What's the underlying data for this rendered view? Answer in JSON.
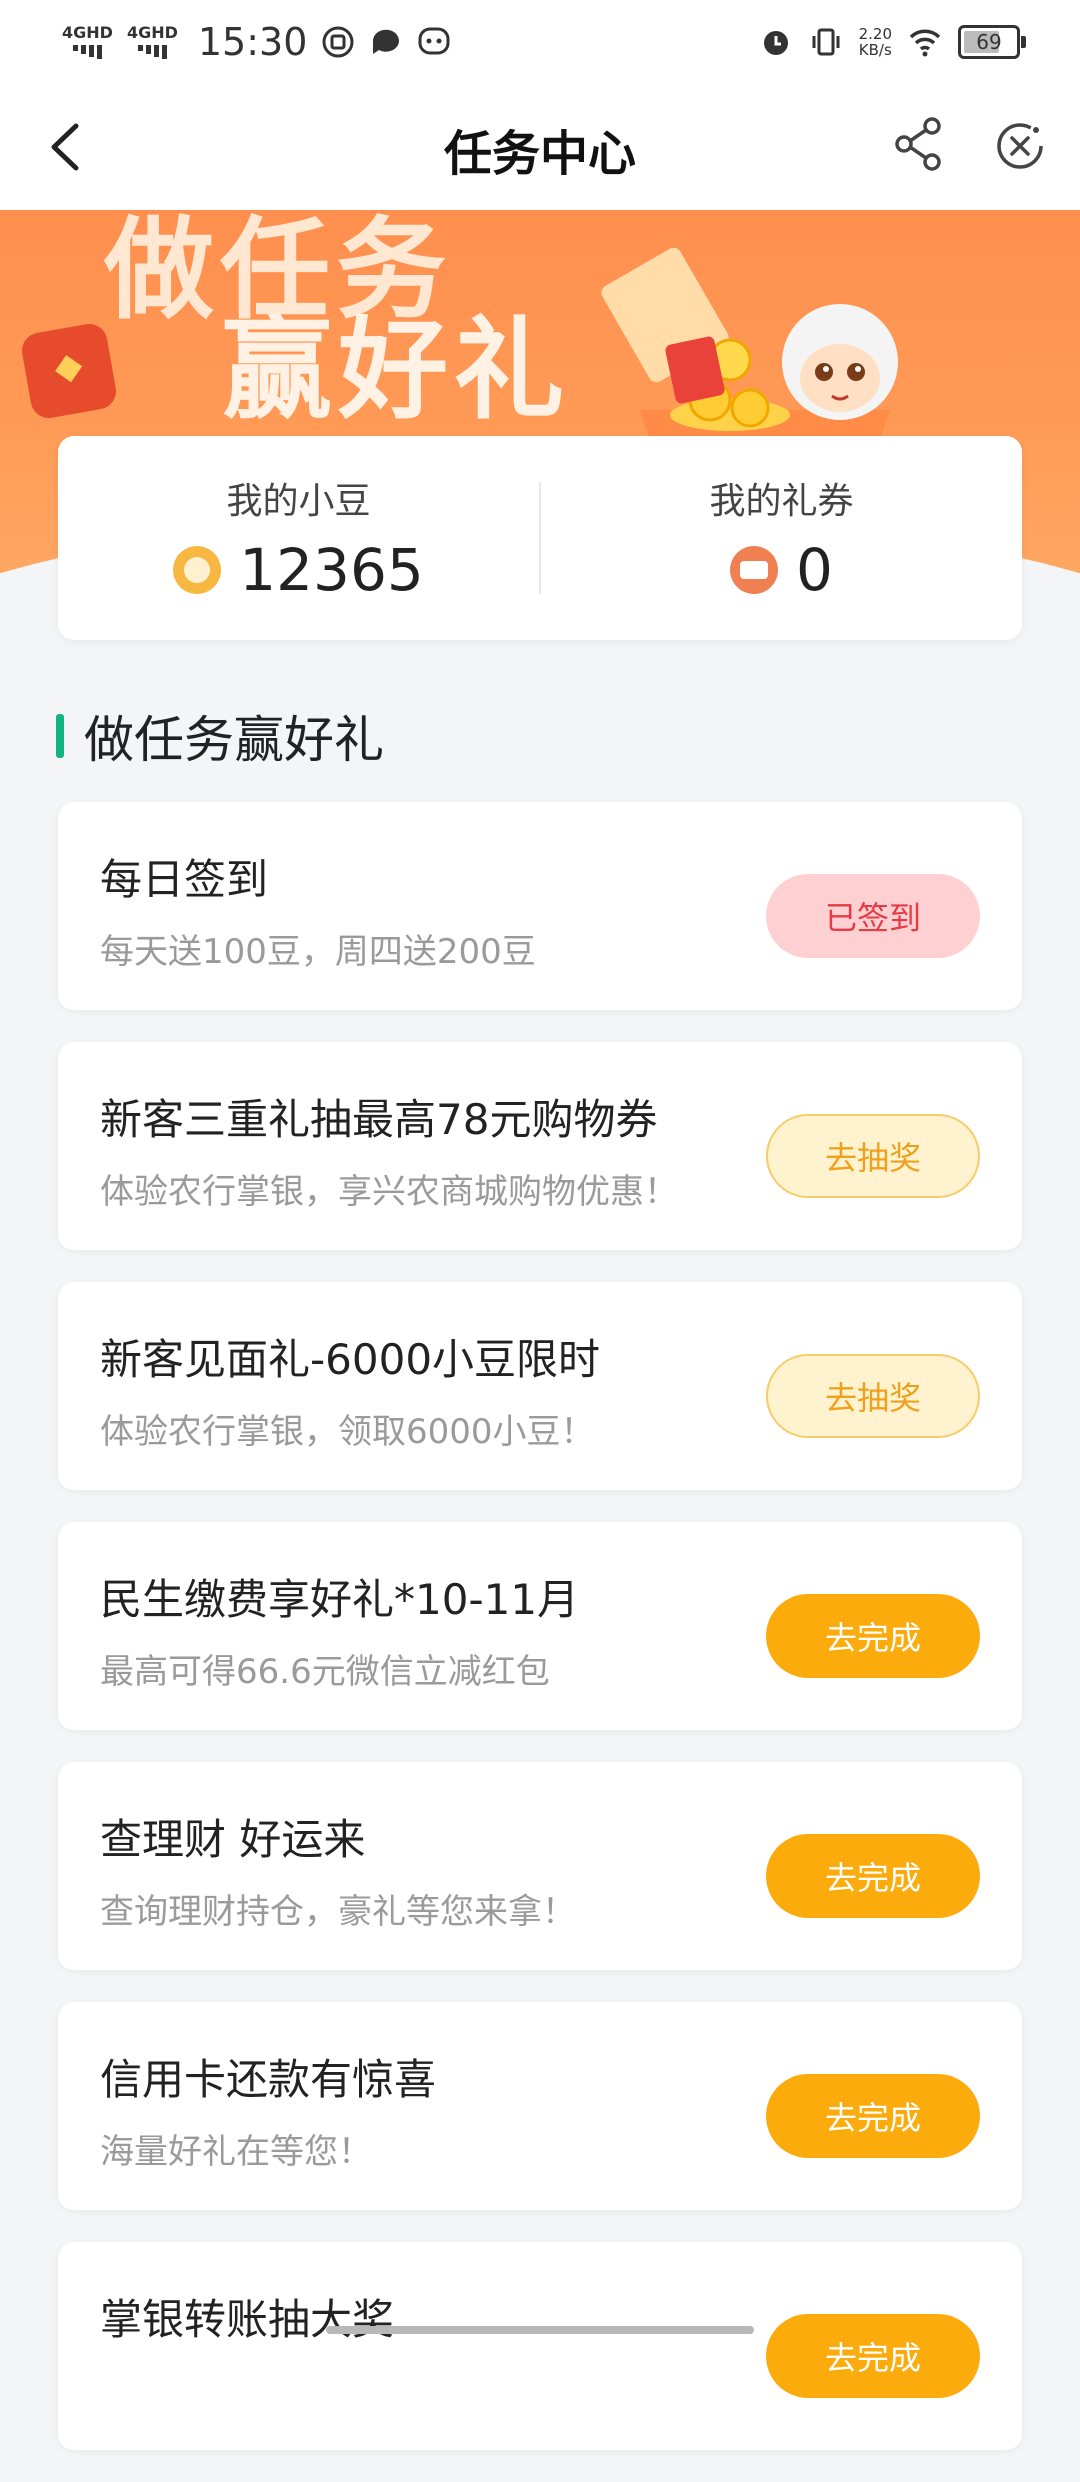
{
  "status_bar": {
    "signal1": "4GHD",
    "signal2": "4GHD",
    "time": "15:30",
    "speed_value": "2.20",
    "speed_unit": "KB/s",
    "battery": "69"
  },
  "nav": {
    "title": "任务中心"
  },
  "banner": {
    "line1": "做任务",
    "line2": "赢好礼"
  },
  "summary": {
    "beans_label": "我的小豆",
    "beans_value": "12365",
    "coupons_label": "我的礼券",
    "coupons_value": "0"
  },
  "section": {
    "title": "做任务赢好礼"
  },
  "tasks": [
    {
      "title": "每日签到",
      "desc": "每天送100豆，周四送200豆",
      "button": "已签到"
    },
    {
      "title": "新客三重礼抽最高78元购物券",
      "desc": "体验农行掌银，享兴农商城购物优惠！",
      "button": "去抽奖"
    },
    {
      "title": "新客见面礼-6000小豆限时",
      "desc": "体验农行掌银，领取6000小豆！",
      "button": "去抽奖"
    },
    {
      "title": "民生缴费享好礼*10-11月",
      "desc": "最高可得66.6元微信立减红包",
      "button": "去完成"
    },
    {
      "title": "查理财 好运来",
      "desc": "查询理财持仓，豪礼等您来拿！",
      "button": "去完成"
    },
    {
      "title": "信用卡还款有惊喜",
      "desc": "海量好礼在等您！",
      "button": "去完成"
    },
    {
      "title": "掌银转账抽大奖",
      "desc": "",
      "button": "去完成"
    }
  ],
  "colors": {
    "accent_green": "#14b384",
    "button_orange": "#fbab0b",
    "signed_bg": "#ffd0d2",
    "signed_text": "#e53b45",
    "banner_orange": "#ff9a56"
  }
}
